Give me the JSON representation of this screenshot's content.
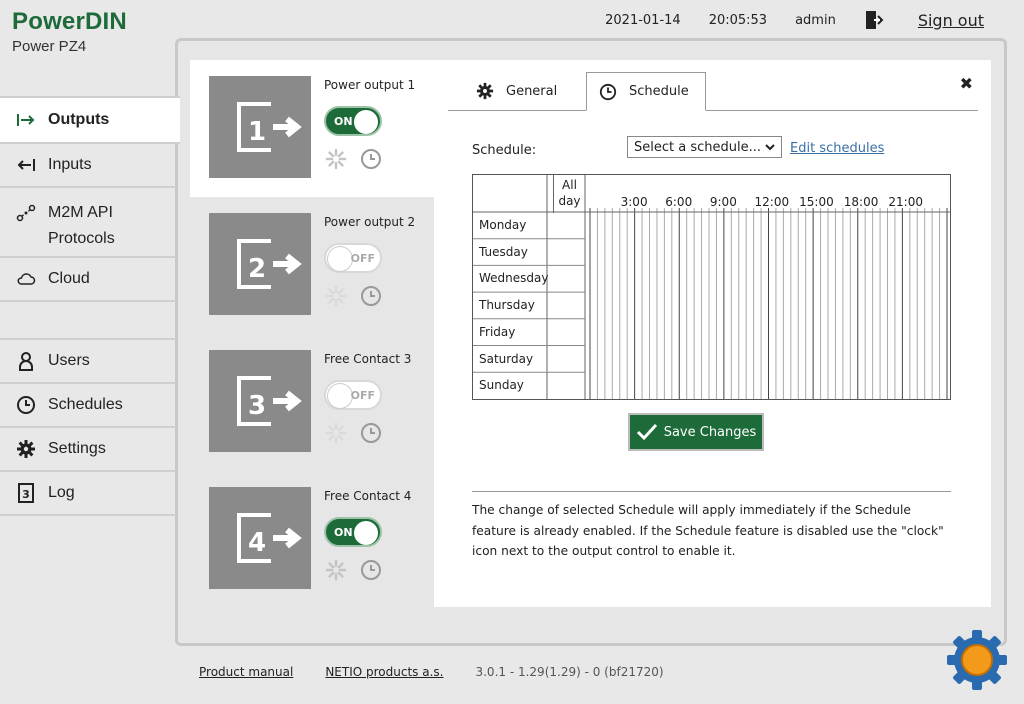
{
  "brand": {
    "title": "PowerDIN",
    "subtitle": "Power PZ4"
  },
  "topbar": {
    "date": "2021-01-14",
    "time": "20:05:53",
    "user": "admin",
    "signout": "Sign out"
  },
  "nav": {
    "outputs": "Outputs",
    "inputs": "Inputs",
    "m2m_line1": "M2M API",
    "m2m_line2": "Protocols",
    "cloud": "Cloud",
    "users": "Users",
    "schedules": "Schedules",
    "settings": "Settings",
    "log": "Log"
  },
  "outputs": [
    {
      "num": "1",
      "name": "Power output 1",
      "state": "ON"
    },
    {
      "num": "2",
      "name": "Power output 2",
      "state": "OFF"
    },
    {
      "num": "3",
      "name": "Free Contact 3",
      "state": "OFF"
    },
    {
      "num": "4",
      "name": "Free Contact 4",
      "state": "ON"
    }
  ],
  "tabs": {
    "general": "General",
    "schedule": "Schedule"
  },
  "schedule": {
    "label": "Schedule:",
    "select_value": "Select a schedule...",
    "edit_link": "Edit schedules",
    "allday_line1": "All",
    "allday_line2": "day",
    "hours": [
      "3:00",
      "6:00",
      "9:00",
      "12:00",
      "15:00",
      "18:00",
      "21:00"
    ],
    "days": [
      "Monday",
      "Tuesday",
      "Wednesday",
      "Thursday",
      "Friday",
      "Saturday",
      "Sunday"
    ],
    "save": "Save Changes",
    "note": "The change of selected Schedule will apply immediately if the Schedule feature is already enabled. If the Schedule feature is disabled use the \"clock\" icon next to the output control to enable it."
  },
  "footer": {
    "manual": "Product manual",
    "company": "NETIO products a.s.",
    "version": "3.0.1 - 1.29(1.29) - 0 (bf21720)"
  },
  "colors": {
    "brand_green": "#1e6b3a",
    "link_blue": "#3a6fa6"
  }
}
